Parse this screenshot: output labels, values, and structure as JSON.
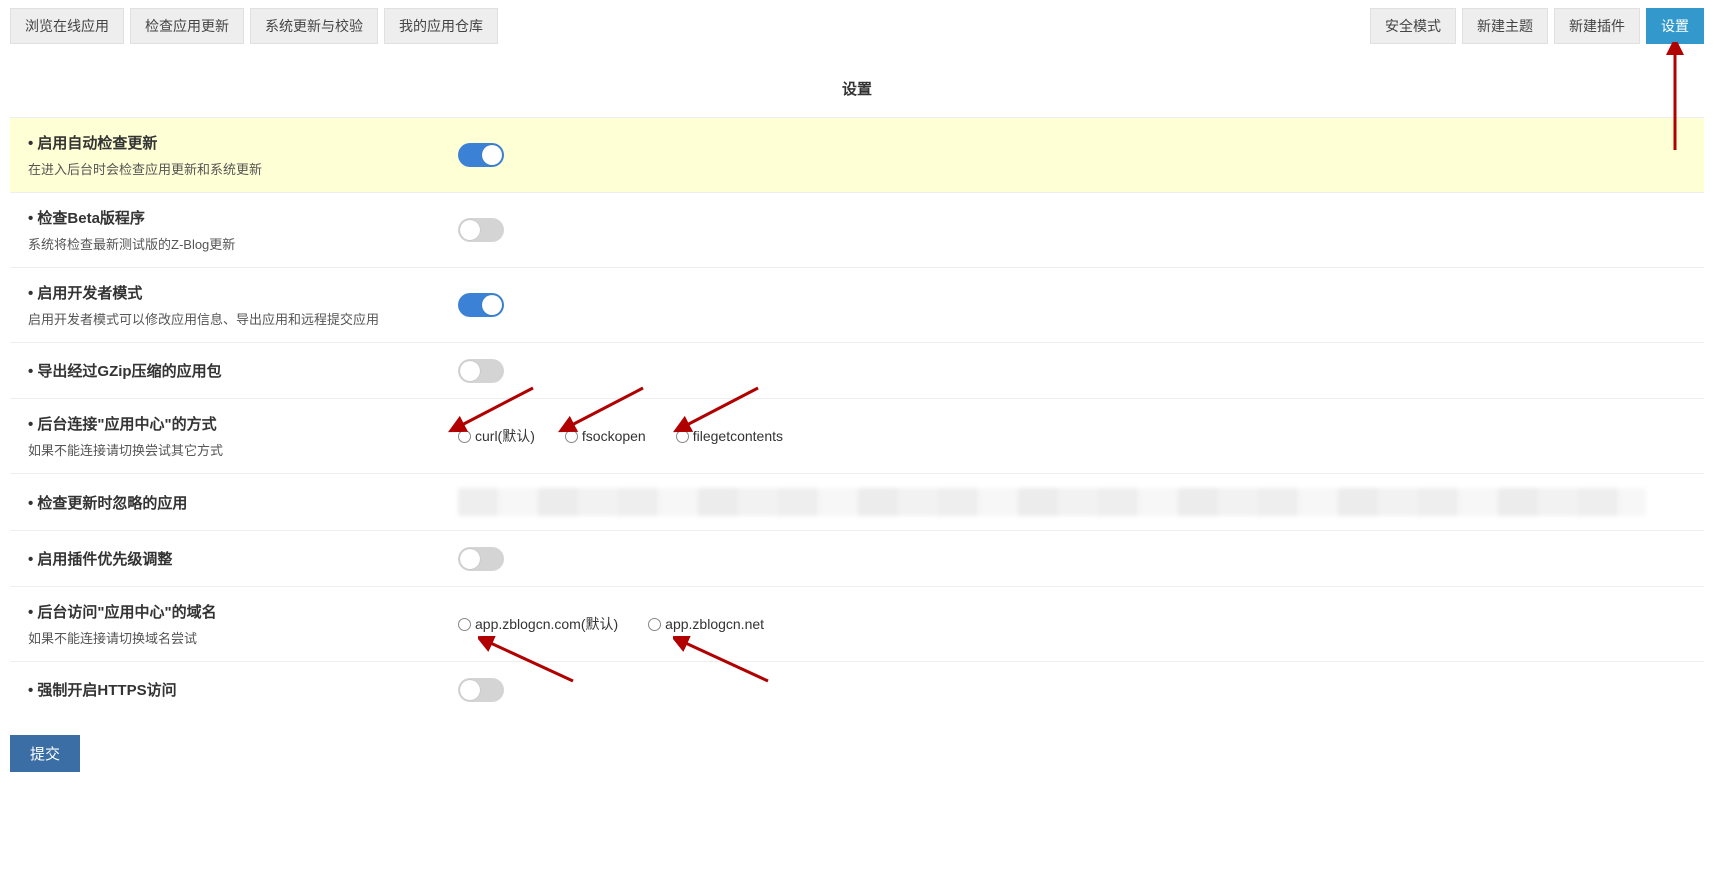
{
  "topbar": {
    "left": [
      "浏览在线应用",
      "检查应用更新",
      "系统更新与校验",
      "我的应用仓库"
    ],
    "right": [
      "安全模式",
      "新建主题",
      "新建插件",
      "设置"
    ],
    "active_right_index": 3
  },
  "panel_title": "设置",
  "rows": [
    {
      "title": "启用自动检查更新",
      "desc": "在进入后台时会检查应用更新和系统更新",
      "type": "toggle",
      "value": true,
      "highlight": true
    },
    {
      "title": "检查Beta版程序",
      "desc": "系统将检查最新测试版的Z-Blog更新",
      "type": "toggle",
      "value": false
    },
    {
      "title": "启用开发者模式",
      "desc": "启用开发者模式可以修改应用信息、导出应用和远程提交应用",
      "type": "toggle",
      "value": true
    },
    {
      "title": "导出经过GZip压缩的应用包",
      "type": "toggle",
      "value": false
    },
    {
      "title": "后台连接\"应用中心\"的方式",
      "desc": "如果不能连接请切换尝试其它方式",
      "type": "radio",
      "options": [
        "curl(默认)",
        "fsockopen",
        "filegetcontents"
      ]
    },
    {
      "title": "检查更新时忽略的应用",
      "type": "blur"
    },
    {
      "title": "启用插件优先级调整",
      "type": "toggle",
      "value": false
    },
    {
      "title": "后台访问\"应用中心\"的域名",
      "desc": "如果不能连接请切换域名尝试",
      "type": "radio",
      "options": [
        "app.zblogcn.com(默认)",
        "app.zblogcn.net"
      ]
    },
    {
      "title": "强制开启HTTPS访问",
      "type": "toggle",
      "value": false
    }
  ],
  "submit_label": "提交"
}
